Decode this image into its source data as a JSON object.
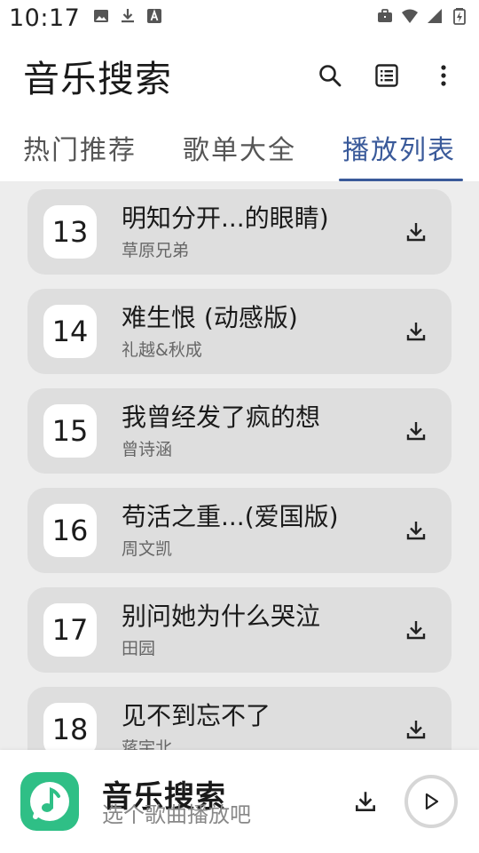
{
  "status_bar": {
    "time": "10:17",
    "left_icons": [
      "image-icon",
      "download-icon",
      "a-icon"
    ],
    "right_icons": [
      "briefcase-icon",
      "wifi-icon",
      "signal-icon",
      "battery-icon"
    ]
  },
  "app_bar": {
    "title": "音乐搜索",
    "actions": [
      "search-icon",
      "list-icon",
      "more-vert-icon"
    ]
  },
  "tabs": [
    {
      "label": "热门推荐",
      "active": false
    },
    {
      "label": "歌单大全",
      "active": false
    },
    {
      "label": "播放列表",
      "active": true
    }
  ],
  "songs": [
    {
      "num": "13",
      "title": "明知分开...的眼睛)",
      "artist": "草原兄弟"
    },
    {
      "num": "14",
      "title": "难生恨 (动感版)",
      "artist": "礼越&秋成"
    },
    {
      "num": "15",
      "title": "我曾经发了疯的想",
      "artist": "曾诗涵"
    },
    {
      "num": "16",
      "title": "苟活之重...(爱国版)",
      "artist": "周文凯"
    },
    {
      "num": "17",
      "title": "别问她为什么哭泣",
      "artist": "田园"
    },
    {
      "num": "18",
      "title": "见不到忘不了",
      "artist": "蒋宇北"
    }
  ],
  "player": {
    "title": "音乐搜索",
    "subtitle": "选个歌曲播放吧"
  },
  "colors": {
    "accent": "#3a5a9a",
    "logo": "#2fbf86",
    "card": "#dedede",
    "list_bg": "#ededed"
  }
}
